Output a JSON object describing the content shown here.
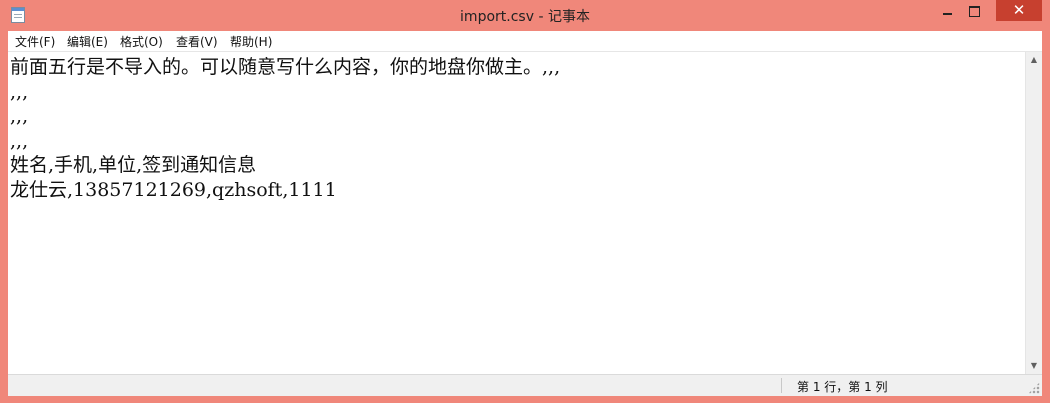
{
  "window": {
    "title": "import.csv - 记事本",
    "close_glyph": "✕"
  },
  "menu": [
    {
      "label": "文件(F)"
    },
    {
      "label": "编辑(E)"
    },
    {
      "label": "格式(O)"
    },
    {
      "label": "查看(V)"
    },
    {
      "label": "帮助(H)"
    }
  ],
  "document": {
    "lines": [
      "前面五行是不导入的。可以随意写什么内容，你的地盘你做主。,,,",
      ",,,",
      ",,,",
      ",,,",
      "姓名,手机,单位,签到通知信息",
      "龙仕云,13857121269,qzhsoft,1111"
    ]
  },
  "scrollbar": {
    "up_glyph": "▲",
    "down_glyph": "▼"
  },
  "status": {
    "position": "第 1 行，第 1 列"
  },
  "icons": {
    "app": "notepad-icon",
    "minimize": "minimize-icon",
    "maximize": "maximize-icon",
    "close": "close-icon"
  },
  "colors": {
    "frame": "#f0877a",
    "close_button": "#c7402f"
  }
}
